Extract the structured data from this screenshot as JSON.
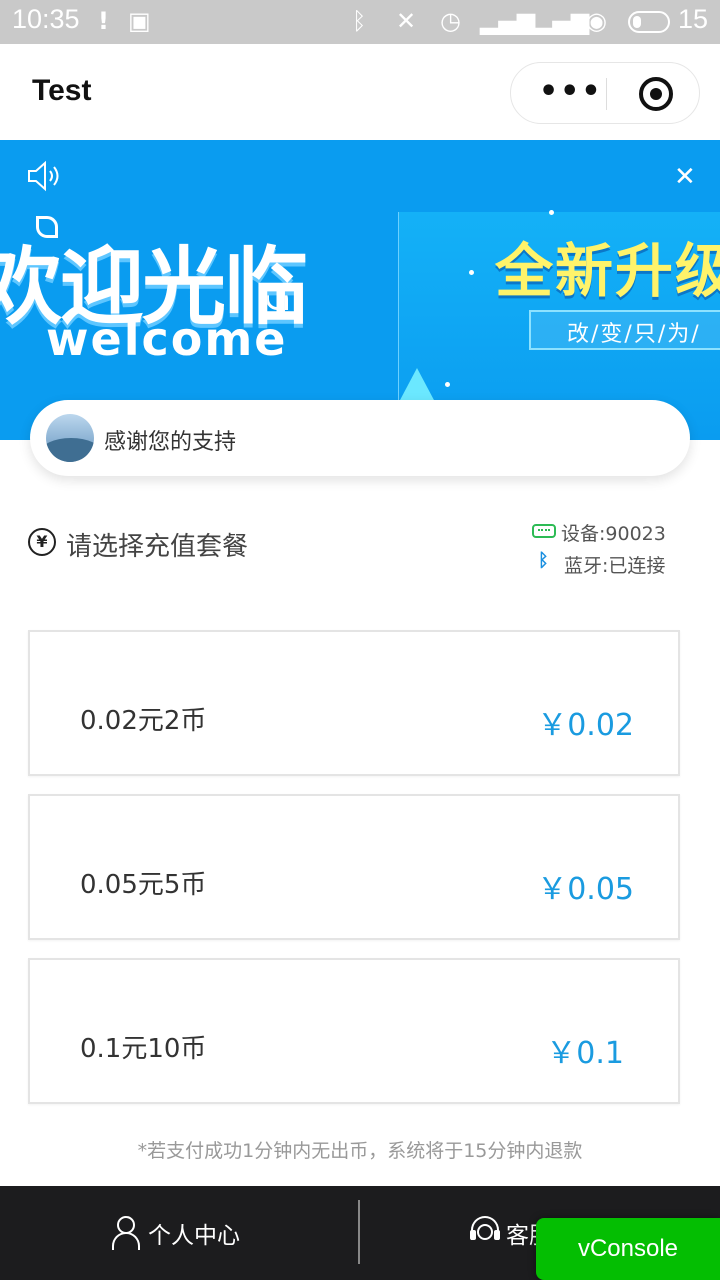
{
  "status_bar": {
    "time": "10:35",
    "battery_level": "15"
  },
  "nav": {
    "title": "Test"
  },
  "banner": {
    "welcome_cn": "欢迎光临",
    "welcome_en": "welcome",
    "upgrade": "全新升级",
    "slogan": "改/变/只/为/",
    "colors": {
      "background": "#0a9cf0",
      "upgrade": "#fff36a"
    }
  },
  "notice": {
    "text": "感谢您的支持"
  },
  "recharge": {
    "title": "请选择充值套餐",
    "device": "设备:90023",
    "bluetooth": "蓝牙:已连接"
  },
  "packages": [
    {
      "name": "0.02元2币",
      "price": "￥0.02"
    },
    {
      "name": "0.05元5币",
      "price": "￥0.05"
    },
    {
      "name": "0.1元10币",
      "price": "￥0.1"
    }
  ],
  "footnote": "*若支付成功1分钟内无出币，系统将于15分钟内退款",
  "tabs": {
    "personal": "个人中心",
    "service": "客服"
  },
  "vconsole": "vConsole",
  "accent_color": "#1a9be0"
}
